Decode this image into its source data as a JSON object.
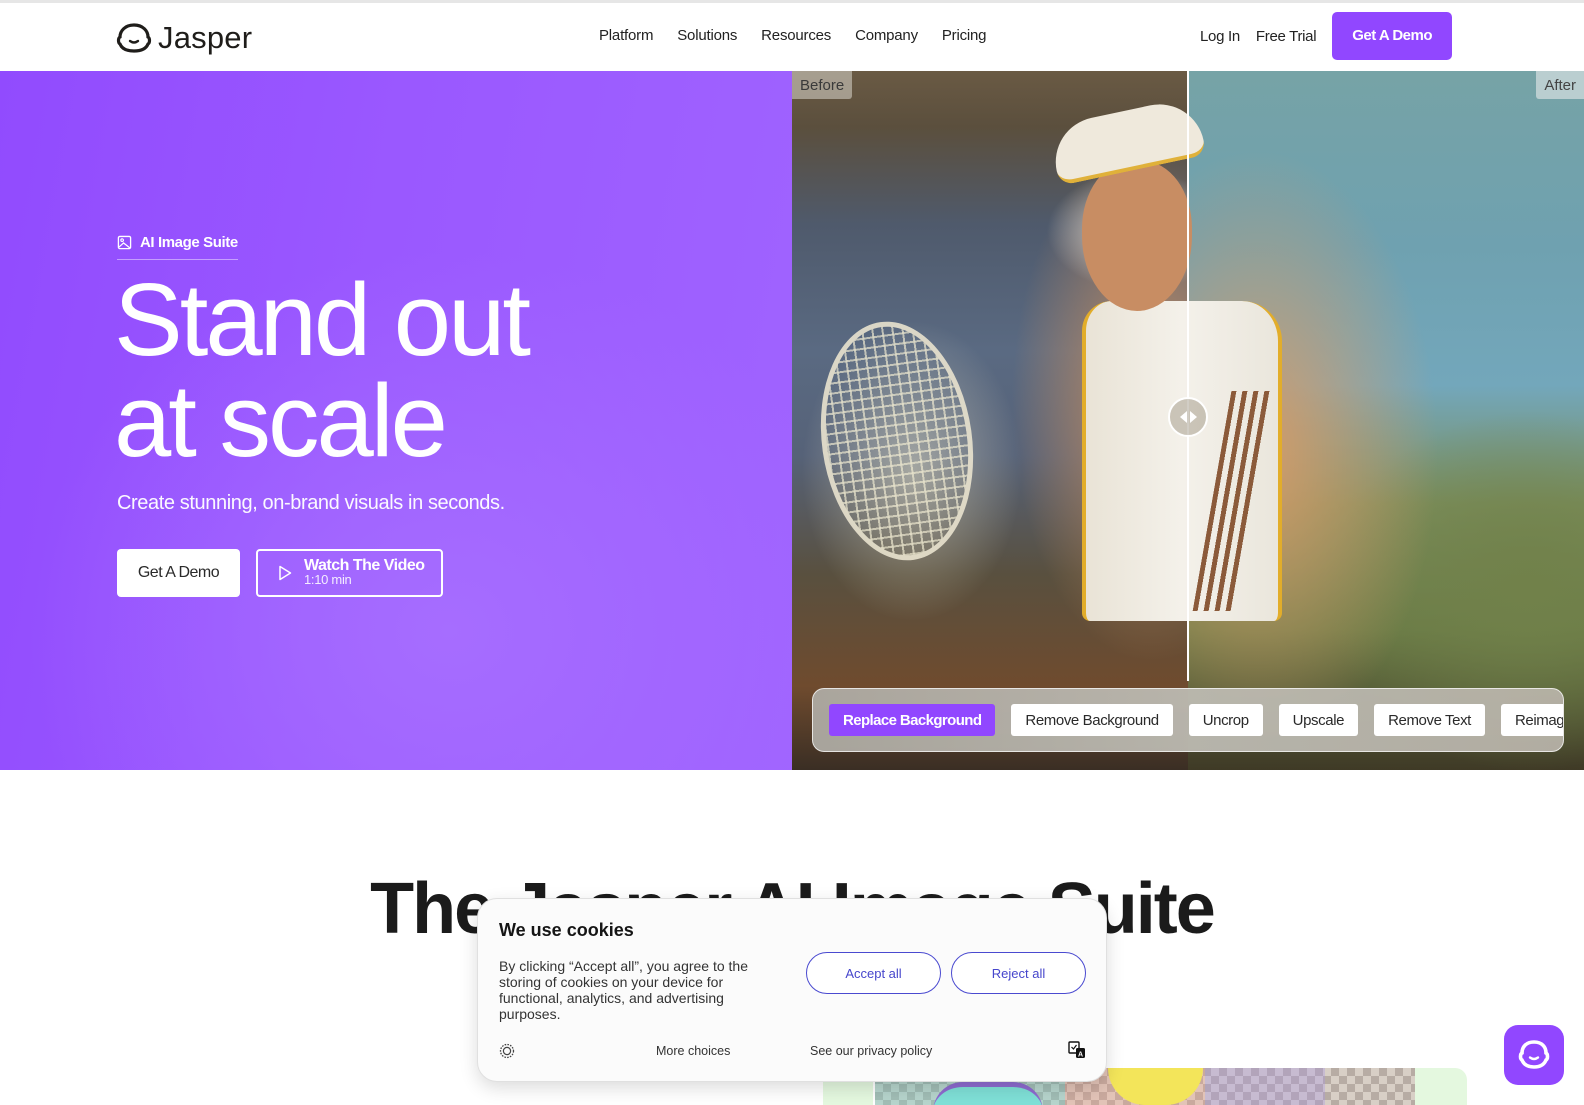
{
  "nav": {
    "brand": "Jasper",
    "links": [
      "Platform",
      "Solutions",
      "Resources",
      "Company",
      "Pricing"
    ],
    "login": "Log In",
    "free_trial": "Free Trial",
    "demo": "Get A Demo",
    "accent_color": "#9147ff"
  },
  "hero": {
    "badge_icon": "image-icon",
    "badge": "AI Image Suite",
    "headline_line1": "Stand out",
    "headline_line2": "at scale",
    "subtitle": "Create stunning, on-brand visuals in seconds.",
    "primary_button": "Get A Demo",
    "video_button": {
      "icon": "play-icon",
      "title": "Watch The Video",
      "duration": "1:10 min"
    }
  },
  "compare": {
    "before_label": "Before",
    "after_label": "After",
    "slider_position_percent": 50,
    "tools": [
      {
        "label": "Replace Background",
        "active": true
      },
      {
        "label": "Remove Background",
        "active": false
      },
      {
        "label": "Uncrop",
        "active": false
      },
      {
        "label": "Upscale",
        "active": false
      },
      {
        "label": "Remove Text",
        "active": false
      },
      {
        "label": "Reimagine",
        "active": false
      }
    ]
  },
  "section": {
    "title": "The Jasper AI Image Suite"
  },
  "cookie": {
    "title": "We use cookies",
    "body": "By clicking “Accept all”, you agree to the storing of cookies on your device for functional, analytics, and advertising purposes.",
    "accept": "Accept all",
    "reject": "Reject all",
    "more": "More choices",
    "privacy": "See our privacy policy",
    "link_color": "#4646cc"
  },
  "chat": {
    "icon": "jasper-chat-icon"
  }
}
